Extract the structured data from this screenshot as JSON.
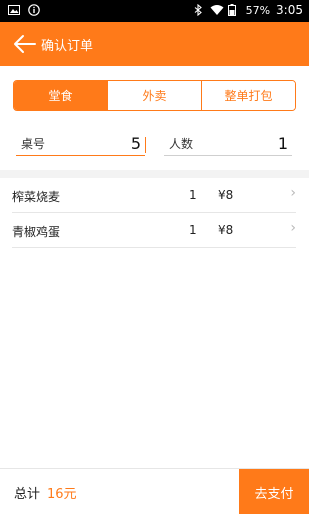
{
  "status_bar": {
    "battery": "57%",
    "time": "3:05",
    "icons": [
      "image-icon",
      "info-icon",
      "bluetooth-icon",
      "wifi-icon",
      "battery-icon"
    ]
  },
  "app_bar": {
    "title": "确认订单",
    "background": "#ff7a19",
    "back_icon": "back-arrow-icon"
  },
  "tabs": [
    {
      "label": "堂食",
      "active": true
    },
    {
      "label": "外卖",
      "active": false
    },
    {
      "label": "整单打包",
      "active": false
    }
  ],
  "fields": {
    "table": {
      "label": "桌号",
      "value": "5"
    },
    "people": {
      "label": "人数",
      "value": "1"
    }
  },
  "order_items": [
    {
      "name": "榨菜烧麦",
      "qty": "1",
      "price": "¥8"
    },
    {
      "name": "青椒鸡蛋",
      "qty": "1",
      "price": "¥8"
    }
  ],
  "footer": {
    "total_label": "总计",
    "total_value": "16元",
    "pay_label": "去支付"
  },
  "colors": {
    "accent": "#ff7a19"
  }
}
